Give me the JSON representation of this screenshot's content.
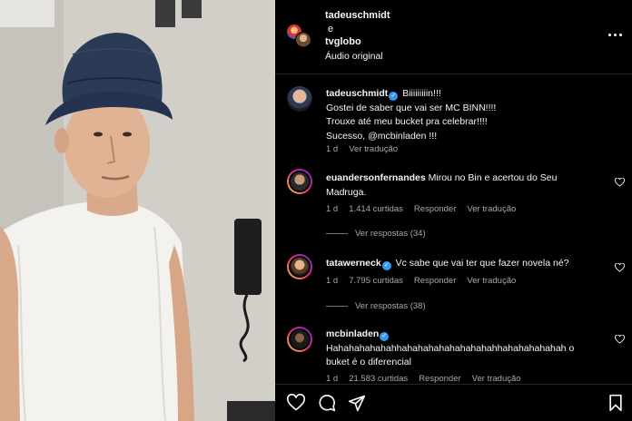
{
  "header": {
    "user_primary": "tadeuschmidt",
    "conjunction": "e",
    "user_secondary": "tvglobo",
    "audio": "Áudio original",
    "more_icon": "more-horizontal-icon"
  },
  "caption": {
    "username": "tadeuschmidt",
    "verified": true,
    "text_line1": "Biiiiiiiiin!!!",
    "text_line2": "Gostei de saber que vai ser MC BINN!!!!",
    "text_line3": "Trouxe até meu bucket pra celebrar!!!!",
    "text_line4": "Sucesso, @mcbinladen !!!",
    "time": "1 d",
    "translate": "Ver tradução"
  },
  "comments": [
    {
      "username": "euandersonfernandes",
      "verified": false,
      "text_a": "Mirou no Bin e acertou do Seu",
      "text_b": "Madruga.",
      "time": "1 d",
      "likes": "1.414 curtidas",
      "reply": "Responder",
      "translate": "Ver tradução",
      "replies": "Ver respostas (34)"
    },
    {
      "username": "tatawerneck",
      "verified": true,
      "text_a": "Vc sabe que vai ter que fazer novela né?",
      "time": "1 d",
      "likes": "7.795 curtidas",
      "reply": "Responder",
      "translate": "Ver tradução",
      "replies": "Ver respostas (38)"
    },
    {
      "username": "mcbinladen",
      "verified": true,
      "text_a": "Hahahahahahahhahahahahahahahahahhahahahahahah o",
      "text_b": "buket é o diferencial",
      "time": "1 d",
      "likes": "21.583 curtidas",
      "reply": "Responder",
      "translate": "Ver tradução"
    }
  ],
  "actions": {
    "like_icon": "heart-icon",
    "comment_icon": "comment-icon",
    "share_icon": "send-icon",
    "save_icon": "bookmark-icon"
  },
  "colors": {
    "background": "#000000",
    "secondary_text": "#a8a8a8",
    "verified_badge": "#3897f0",
    "divider": "#262626"
  }
}
